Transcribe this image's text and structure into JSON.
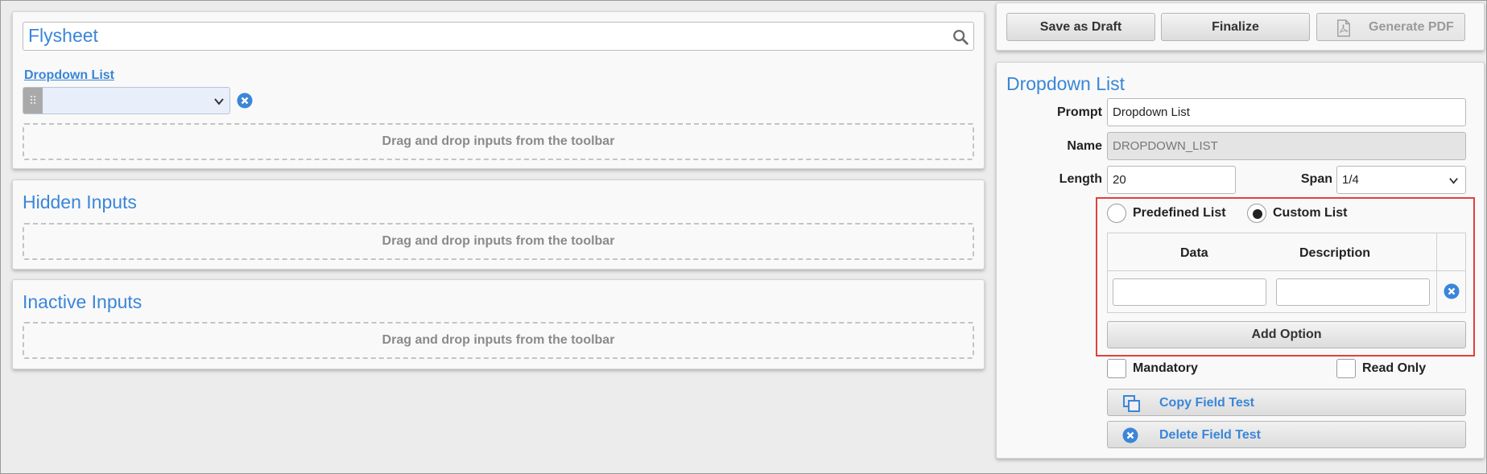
{
  "form": {
    "title": "Flysheet",
    "dropdown_label": "Dropdown List",
    "dropzone_text": "Drag and drop inputs from the toolbar"
  },
  "hidden_section": {
    "title": "Hidden Inputs",
    "dropzone_text": "Drag and drop inputs from the toolbar"
  },
  "inactive_section": {
    "title": "Inactive Inputs",
    "dropzone_text": "Drag and drop inputs from the toolbar"
  },
  "toolbar": {
    "save_draft_label": "Save as Draft",
    "finalize_label": "Finalize",
    "generate_pdf_label": "Generate PDF"
  },
  "properties": {
    "title": "Dropdown List",
    "prompt_label": "Prompt",
    "prompt_value": "Dropdown List",
    "name_label": "Name",
    "name_value": "DROPDOWN_LIST",
    "length_label": "Length",
    "length_value": "20",
    "span_label": "Span",
    "span_value": "1/4",
    "predefined_label": "Predefined List",
    "custom_label": "Custom List",
    "list_type_selected": "custom",
    "table_headers": [
      "Data",
      "Description"
    ],
    "add_option_label": "Add Option",
    "mandatory_label": "Mandatory",
    "read_only_label": "Read Only",
    "copy_label": "Copy Field Test",
    "delete_label": "Delete Field Test"
  },
  "colors": {
    "accent": "#3a86d8",
    "highlight": "#e0413e",
    "background": "#ececec"
  }
}
